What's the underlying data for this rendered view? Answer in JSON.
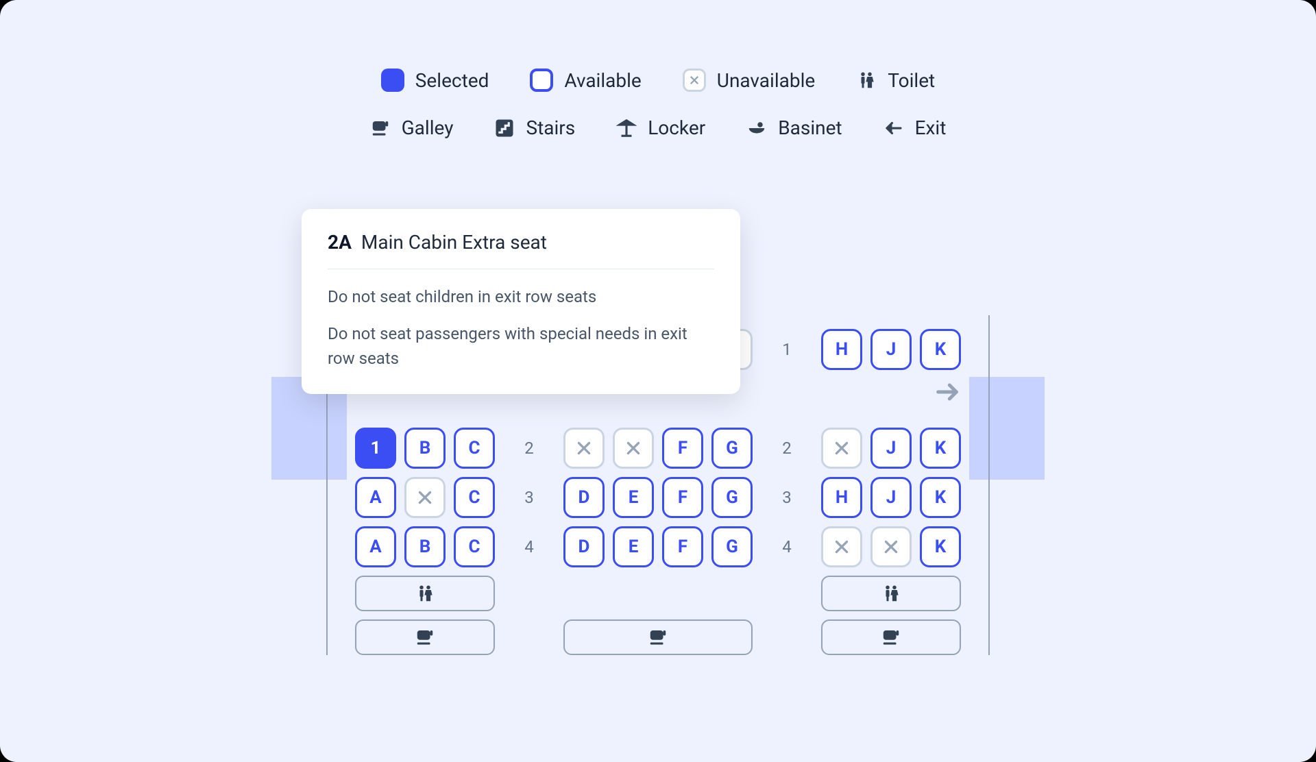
{
  "legend": {
    "selected": "Selected",
    "available": "Available",
    "unavailable": "Unavailable",
    "toilet": "Toilet",
    "galley": "Galley",
    "stairs": "Stairs",
    "locker": "Locker",
    "basinet": "Basinet",
    "exit": "Exit"
  },
  "popover": {
    "seat": "2A",
    "type": "Main Cabin Extra seat",
    "notes": [
      "Do not seat children in exit row seats",
      "Do not seat passengers with special needs in exit row seats"
    ]
  },
  "rows": {
    "r1": "1",
    "r2": "2",
    "r3": "3",
    "r4": "4"
  },
  "blocks": {
    "left": {
      "r1": [],
      "r2": [
        {
          "l": "1",
          "s": "selected"
        },
        {
          "l": "B",
          "s": "available"
        },
        {
          "l": "C",
          "s": "available"
        }
      ],
      "r3": [
        {
          "l": "A",
          "s": "available"
        },
        {
          "l": "",
          "s": "unavailable"
        },
        {
          "l": "C",
          "s": "available"
        }
      ],
      "r4": [
        {
          "l": "A",
          "s": "available"
        },
        {
          "l": "B",
          "s": "available"
        },
        {
          "l": "C",
          "s": "available"
        }
      ]
    },
    "mid": {
      "r1": [
        {
          "l": "",
          "s": "unavailable"
        },
        {
          "l": "",
          "s": "unavailable"
        },
        {
          "l": "",
          "s": "unavailable"
        },
        {
          "l": "",
          "s": "unavailable"
        }
      ],
      "r2": [
        {
          "l": "",
          "s": "unavailable"
        },
        {
          "l": "",
          "s": "unavailable"
        },
        {
          "l": "F",
          "s": "available"
        },
        {
          "l": "G",
          "s": "available"
        }
      ],
      "r3": [
        {
          "l": "D",
          "s": "available"
        },
        {
          "l": "E",
          "s": "available"
        },
        {
          "l": "F",
          "s": "available"
        },
        {
          "l": "G",
          "s": "available"
        }
      ],
      "r4": [
        {
          "l": "D",
          "s": "available"
        },
        {
          "l": "E",
          "s": "available"
        },
        {
          "l": "F",
          "s": "available"
        },
        {
          "l": "G",
          "s": "available"
        }
      ]
    },
    "right": {
      "r1": [
        {
          "l": "H",
          "s": "available"
        },
        {
          "l": "J",
          "s": "available"
        },
        {
          "l": "K",
          "s": "available"
        }
      ],
      "r2": [
        {
          "l": "",
          "s": "unavailable"
        },
        {
          "l": "J",
          "s": "available"
        },
        {
          "l": "K",
          "s": "available"
        }
      ],
      "r3": [
        {
          "l": "H",
          "s": "available"
        },
        {
          "l": "J",
          "s": "available"
        },
        {
          "l": "K",
          "s": "available"
        }
      ],
      "r4": [
        {
          "l": "",
          "s": "unavailable"
        },
        {
          "l": "",
          "s": "unavailable"
        },
        {
          "l": "K",
          "s": "available"
        }
      ]
    }
  },
  "facilities": {
    "left": [
      "toilet",
      "galley"
    ],
    "mid": [
      null,
      "galley"
    ],
    "right": [
      "toilet",
      "galley"
    ]
  }
}
